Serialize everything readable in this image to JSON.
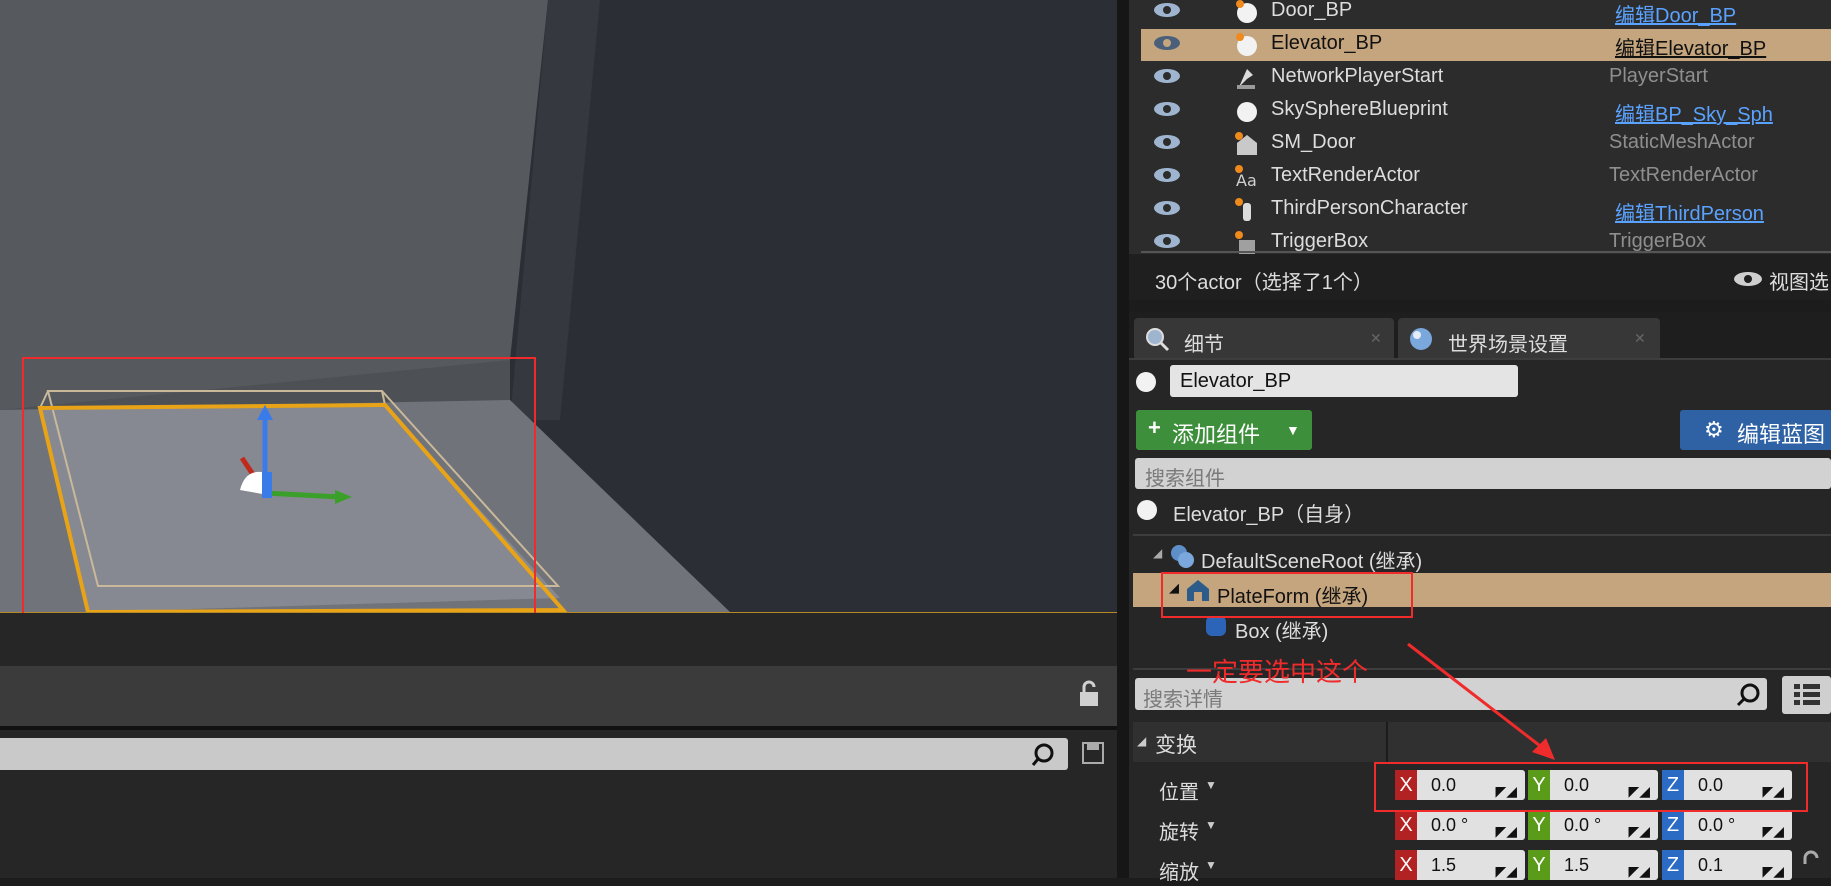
{
  "outliner": {
    "rows": [
      {
        "name": "Door_BP",
        "type": "编辑Door_BP",
        "type_link": true,
        "selected": false,
        "icon": "blueprint-sphere-icon"
      },
      {
        "name": "Elevator_BP",
        "type": "编辑Elevator_BP",
        "type_link": true,
        "selected": true,
        "icon": "blueprint-sphere-icon"
      },
      {
        "name": "NetworkPlayerStart",
        "type": "PlayerStart",
        "type_link": false,
        "selected": false,
        "icon": "player-start-icon"
      },
      {
        "name": "SkySphereBlueprint",
        "type": "编辑BP_Sky_Sph",
        "type_link": true,
        "selected": false,
        "icon": "sphere-icon"
      },
      {
        "name": "SM_Door",
        "type": "StaticMeshActor",
        "type_link": false,
        "selected": false,
        "icon": "static-mesh-icon"
      },
      {
        "name": "TextRenderActor",
        "type": "TextRenderActor",
        "type_link": false,
        "selected": false,
        "icon": "text-render-icon"
      },
      {
        "name": "ThirdPersonCharacter",
        "type": "编辑ThirdPerson",
        "type_link": true,
        "selected": false,
        "icon": "character-icon"
      },
      {
        "name": "TriggerBox",
        "type": "TriggerBox",
        "type_link": false,
        "selected": false,
        "icon": "trigger-box-icon"
      }
    ],
    "footer_count": "30个actor（选择了1个）",
    "footer_view": "视图选"
  },
  "details": {
    "tabs": [
      {
        "label": "细节"
      },
      {
        "label": "世界场景设置"
      }
    ],
    "actor_name": "Elevator_BP",
    "add_component": "添加组件",
    "edit_blueprint": "编辑蓝图",
    "component_search_placeholder": "搜索组件",
    "self_row": "Elevator_BP（自身）",
    "components": [
      {
        "label": "DefaultSceneRoot (继承)",
        "icon": "scene-root-icon"
      },
      {
        "label": "PlateForm (继承)",
        "icon": "static-mesh-icon"
      },
      {
        "label": "Box (继承)",
        "icon": "box-collision-icon"
      }
    ],
    "detail_search_placeholder": "搜索详情",
    "transform_header": "变换",
    "transform": [
      {
        "label": "位置",
        "x": "0.0",
        "y": "0.0",
        "z": "0.0"
      },
      {
        "label": "旋转",
        "x": "0.0 °",
        "y": "0.0 °",
        "z": "0.0 °"
      },
      {
        "label": "缩放",
        "x": "1.5",
        "y": "1.5",
        "z": "0.1"
      }
    ],
    "axis_labels": {
      "x": "X",
      "y": "Y",
      "z": "Z"
    }
  },
  "annotation": {
    "text": "一定要选中这个",
    "color": "#ef2b2b"
  },
  "colors": {
    "selection": "#c4a57d",
    "link": "#5aa2ff",
    "add_button": "#3e8f3b",
    "blueprint_button": "#2e62a5",
    "viewport_select_outline": "#e8a317"
  }
}
